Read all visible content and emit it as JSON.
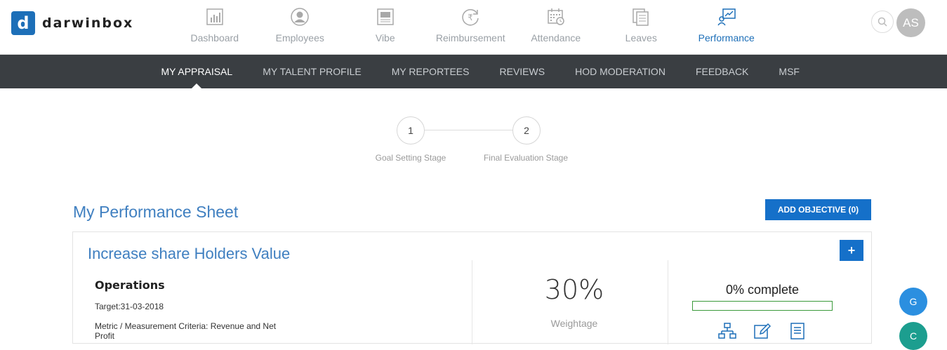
{
  "app": {
    "logo_mark": "d",
    "logo_text": "darwinbox"
  },
  "nav": {
    "items": [
      {
        "label": "Dashboard",
        "icon": "bar-chart-icon"
      },
      {
        "label": "Employees",
        "icon": "person-icon"
      },
      {
        "label": "Vibe",
        "icon": "newspaper-icon"
      },
      {
        "label": "Reimbursement",
        "icon": "rupee-icon"
      },
      {
        "label": "Attendance",
        "icon": "calendar-clock-icon"
      },
      {
        "label": "Leaves",
        "icon": "documents-icon"
      },
      {
        "label": "Performance",
        "icon": "performance-icon",
        "active": true
      }
    ]
  },
  "user": {
    "initials": "AS"
  },
  "subnav": {
    "items": [
      {
        "label": "MY APPRAISAL",
        "active": true
      },
      {
        "label": "MY TALENT PROFILE"
      },
      {
        "label": "MY REPORTEES"
      },
      {
        "label": "REVIEWS"
      },
      {
        "label": "HOD MODERATION"
      },
      {
        "label": "FEEDBACK"
      },
      {
        "label": "MSF"
      }
    ]
  },
  "stepper": {
    "steps": [
      {
        "number": "1",
        "label": "Goal Setting Stage"
      },
      {
        "number": "2",
        "label": "Final Evaluation Stage"
      }
    ]
  },
  "sheet": {
    "title": "My Performance Sheet",
    "add_objective_label": "ADD OBJECTIVE (0)"
  },
  "objective": {
    "title": "Increase share Holders Value",
    "plus_label": "+",
    "category": "Operations",
    "target": "Target:31-03-2018",
    "metric": "Metric / Measurement Criteria: Revenue and Net Profit",
    "weightage_value": "30%",
    "weightage_label": "Weightage",
    "complete_label": "0% complete",
    "progress": 0,
    "progress_color": "#3b9a3b"
  },
  "fabs": [
    {
      "letter": "G",
      "color": "#2b8fe0"
    },
    {
      "letter": "C",
      "color": "#1c9e8f"
    }
  ],
  "colors": {
    "accent": "#1570c9",
    "subnav_bg": "#3a3e42"
  }
}
